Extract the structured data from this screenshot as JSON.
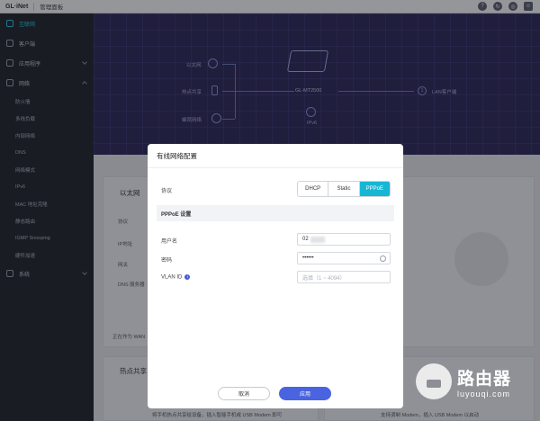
{
  "header": {
    "logo": "GL·iNet",
    "console": "管理面板",
    "icons": [
      "help-icon",
      "refresh-icon",
      "globe-icon",
      "user-icon"
    ]
  },
  "sidebar": {
    "items": [
      {
        "label": "互联网",
        "active": true
      },
      {
        "label": "客户端"
      },
      {
        "label": "应用程序"
      },
      {
        "label": "网络"
      }
    ],
    "subitems": [
      "防火墙",
      "多线负载",
      "内部网络",
      "DNS",
      "网络模式",
      "IPv6",
      "MAC 地址克隆",
      "静态路由",
      "IGMP Snooping",
      "硬件加速"
    ],
    "system": "系统"
  },
  "hero": {
    "ethernet": "以太网",
    "hotspot": "热点共享",
    "cellular": "蜂窝网络",
    "router": "GL-MT2500",
    "ipv6": "IPv6",
    "lan_count": "1",
    "lan": "LAN客户端"
  },
  "background": {
    "ethernet_title": "以太网",
    "protocol": "协议",
    "ip": "IP地址",
    "gateway": "网关",
    "dns": "DNS 服务器",
    "working_as": "正在作为 WAN",
    "hotspot_title": "热点共享",
    "hotspot_desc": "将手机热点共享给设备，插入智能手机或 USB Modem 即可",
    "modem_desc": "支持调制 Modem，插入 USB Modem 以启动"
  },
  "dialog": {
    "title": "有线网络配置",
    "protocol_label": "协议",
    "protocols": [
      "DHCP",
      "Static",
      "PPPoE"
    ],
    "active_protocol": "PPPoE",
    "section": "PPPoE 设置",
    "username_label": "用户名",
    "username_value": "02",
    "password_label": "密码",
    "password_value": "••••••",
    "vlan_label": "VLAN ID",
    "vlan_placeholder": "选填（1 ~ 4094）",
    "cancel": "取消",
    "apply": "应用"
  },
  "watermark": {
    "line1": "路由器",
    "line2": "luyouqi.com"
  },
  "colors": {
    "accent": "#17b6d3",
    "primary_button": "#4a63e0",
    "sidebar_bg": "#1f2229",
    "hero_bg": "#2a2657"
  }
}
